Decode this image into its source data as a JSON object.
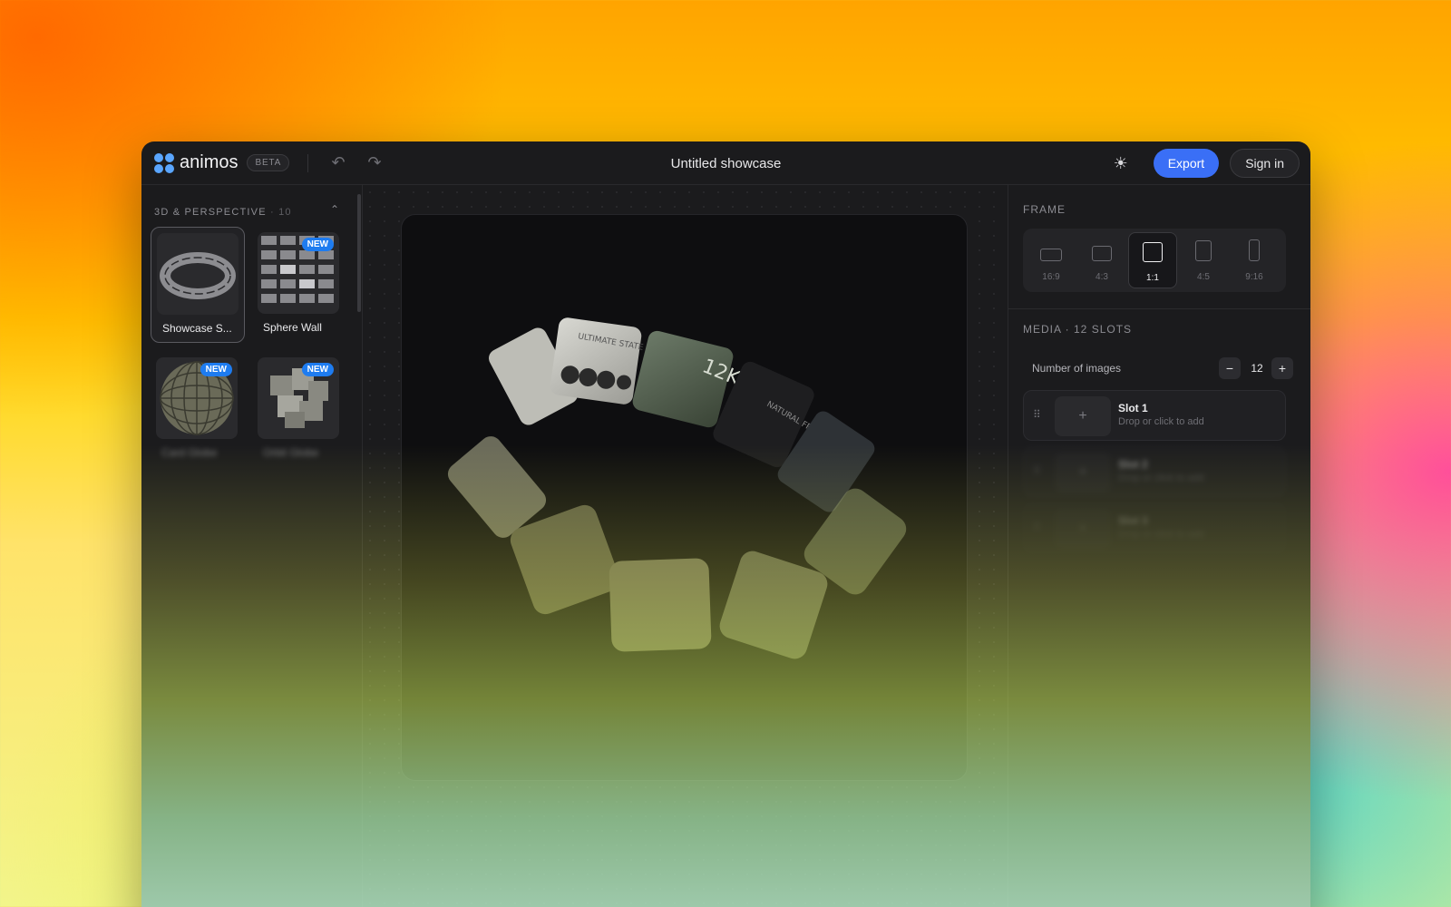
{
  "app": {
    "name": "animos",
    "badge": "BETA",
    "document_title": "Untitled showcase",
    "export_label": "Export",
    "signin_label": "Sign in",
    "accent_color": "#3a6ff6"
  },
  "toolbar": {
    "undo_icon": "↶",
    "redo_icon": "↷",
    "theme_icon": "☀"
  },
  "sidebar": {
    "section_title": "3D & PERSPECTIVE",
    "section_count": "· 10",
    "collapse_icon": "⌃",
    "new_badge": "NEW",
    "templates": [
      {
        "label": "Showcase S...",
        "selected": true,
        "new": false
      },
      {
        "label": "Sphere Wall",
        "selected": false,
        "new": true
      },
      {
        "label": "Card Globe",
        "selected": false,
        "new": true
      },
      {
        "label": "Orbit Globe",
        "selected": false,
        "new": true
      }
    ]
  },
  "right_panel": {
    "frame_title": "FRAME",
    "ratios": [
      {
        "label": "16:9",
        "selected": false
      },
      {
        "label": "4:3",
        "selected": false
      },
      {
        "label": "1:1",
        "selected": true
      },
      {
        "label": "4:5",
        "selected": false
      },
      {
        "label": "9:16",
        "selected": false
      }
    ],
    "media_title": "MEDIA · 12 SLOTS",
    "number_label": "Number of images",
    "decrement": "−",
    "increment": "+",
    "number_value": "12",
    "slot_add_icon": "+",
    "slot_grip_icon": "⠿",
    "slots": [
      {
        "title": "Slot 1",
        "subtitle": "Drop or click to add"
      },
      {
        "title": "Slot 2",
        "subtitle": "Drop or click to add"
      },
      {
        "title": "Slot 3",
        "subtitle": "Drop or click to add"
      }
    ]
  },
  "canvas": {
    "card_texts": [
      "ULTIMATE STATE",
      "12K",
      "NATURAL FRESH"
    ]
  }
}
